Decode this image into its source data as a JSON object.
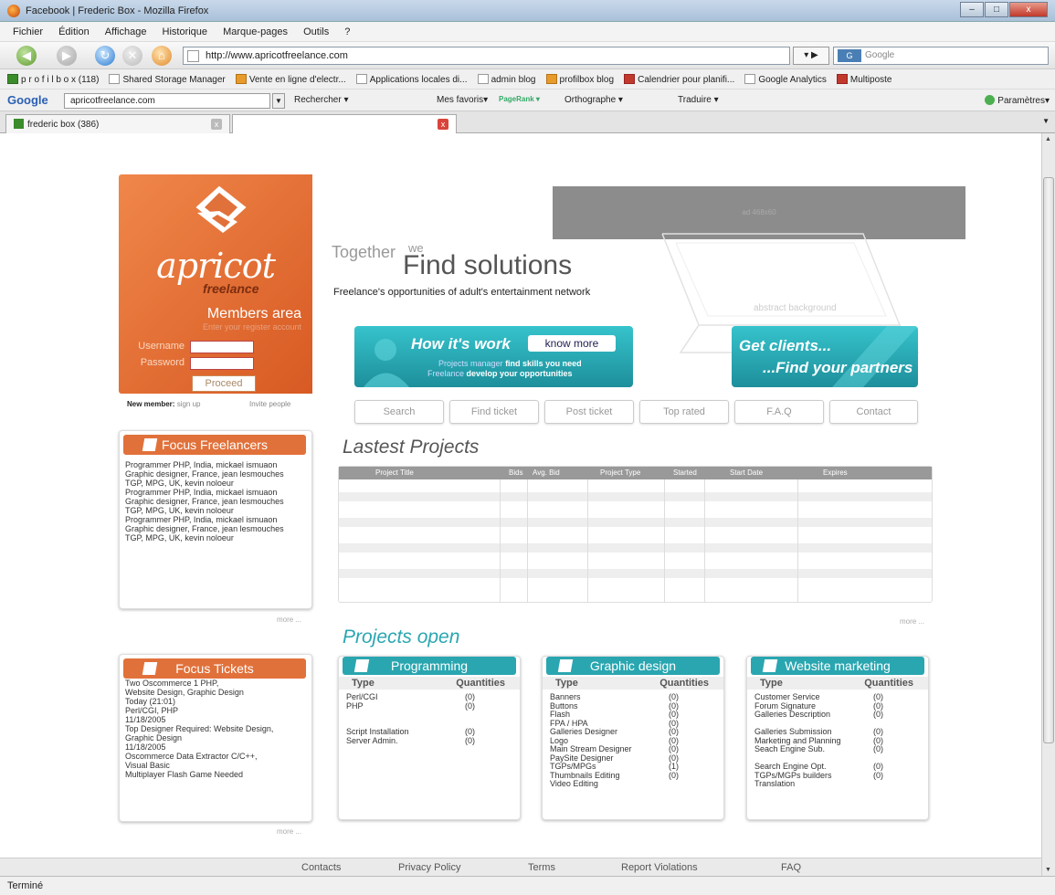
{
  "window": {
    "title": "Facebook | Frederic Box - Mozilla Firefox",
    "buttons": [
      "–",
      "□",
      "x"
    ]
  },
  "menu": [
    "Fichier",
    "Édition",
    "Affichage",
    "Historique",
    "Marque-pages",
    "Outils",
    "?"
  ],
  "nav": {
    "url": "http://www.apricotfreelance.com",
    "search_placeholder": "Google",
    "search_engine": "G"
  },
  "bookmarks": [
    {
      "label": "p r o f i l b o x (118)",
      "icon": "green"
    },
    {
      "label": "Shared Storage Manager",
      "icon": "doc"
    },
    {
      "label": "Vente en ligne d'electr...",
      "icon": "orange"
    },
    {
      "label": "Applications locales di...",
      "icon": "doc"
    },
    {
      "label": "admin blog",
      "icon": "doc"
    },
    {
      "label": "profilbox blog",
      "icon": "orange"
    },
    {
      "label": "Calendrier pour planifi...",
      "icon": "red"
    },
    {
      "label": "Google Analytics",
      "icon": "doc"
    },
    {
      "label": "Multiposte",
      "icon": "red"
    }
  ],
  "google_toolbar": {
    "logo": "Google",
    "input": "apricotfreelance.com",
    "items": [
      "Rechercher ▾",
      "Mes favoris▾",
      "PageRank ▾",
      "Orthographe ▾",
      "Traduire ▾"
    ],
    "settings": "Paramètres▾"
  },
  "tabs": [
    {
      "label": "frederic box (386)"
    },
    {
      "label": ""
    }
  ],
  "status": "Terminé",
  "site": {
    "logo_text": "apricot",
    "logo_sub": "freelance",
    "members_title": "Members area",
    "members_sub": "Enter your register account",
    "username_label": "Username",
    "password_label": "Password",
    "proceed": "Proceed",
    "new_member": "New member:",
    "sign_up": "sign up",
    "invite": "Invite people",
    "topbar_text": "ad 468x60",
    "together": "Together",
    "we": "we",
    "find": "Find solutions",
    "tagline": "Freelance's opportunities of adult's entertainment network",
    "ghost": "abstract background",
    "banner1": {
      "title": "How it's work",
      "btn": "know more",
      "line1a": "Projects manager",
      "line1b": "find skills you need",
      "line2a": "Freelance",
      "line2b": "develop your opportunities"
    },
    "banner2": {
      "title1": "Get clients...",
      "title2": "...Find your partners"
    },
    "navbuttons": [
      "Search",
      "Find ticket",
      "Post ticket",
      "Top rated",
      "F.A.Q",
      "Contact"
    ],
    "focus_freelancers": {
      "title": "Focus Freelancers",
      "lines": [
        "Programmer PHP,  India,  mickael ismuaon",
        "Graphic designer, France,  jean  lesmouches",
        "TGP, MPG,  UK,  kevin noloeur",
        "Programmer PHP,  India,  mickael ismuaon",
        "Graphic designer, France,  jean  lesmouches",
        "TGP, MPG,  UK,  kevin noloeur",
        "Programmer PHP,  India,  mickael ismuaon",
        "Graphic designer, France,  jean  lesmouches",
        "TGP, MPG,  UK,  kevin noloeur"
      ],
      "more": "more ..."
    },
    "focus_tickets": {
      "title": "Focus Tickets",
      "lines": [
        "Two Oscommerce      1 PHP,",
        "Website Design, Graphic Design",
        "Today (21:01)",
        "Perl/CGI, PHP",
        "11/18/2005",
        "Top Designer Required: Website Design,",
        "Graphic Design",
        "11/18/2005",
        "Oscommerce Data Extractor   C/C++,",
        "Visual Basic",
        "Multiplayer Flash Game Needed"
      ],
      "more": "more ..."
    },
    "latest": {
      "title": "Lastest Projects",
      "columns": [
        "Project Title",
        "Bids",
        "Avg. Bid",
        "Project Type",
        "Started",
        "Start Date",
        "Expires"
      ],
      "more": "more ..."
    },
    "projects_open": {
      "title": "Projects open",
      "type_label": "Type",
      "qty_label": "Quantities",
      "boxes": [
        {
          "title": "Programming",
          "rows": [
            {
              "type": "Perl/CGI",
              "qty": "(0)"
            },
            {
              "type": "PHP",
              "qty": "(0)"
            },
            {
              "type": "",
              "qty": ""
            },
            {
              "type": "",
              "qty": ""
            },
            {
              "type": "Script Installation",
              "qty": "(0)"
            },
            {
              "type": "Server Admin.",
              "qty": "(0)"
            }
          ]
        },
        {
          "title": "Graphic design",
          "rows": [
            {
              "type": "Banners",
              "qty": "(0)"
            },
            {
              "type": "Buttons",
              "qty": "(0)"
            },
            {
              "type": "Flash",
              "qty": "(0)"
            },
            {
              "type": "FPA / HPA",
              "qty": "(0)"
            },
            {
              "type": "Galleries Designer",
              "qty": "(0)"
            },
            {
              "type": "Logo",
              "qty": "(0)"
            },
            {
              "type": "Main Stream Designer",
              "qty": "(0)"
            },
            {
              "type": "PaySite Designer",
              "qty": "(0)"
            },
            {
              "type": "TGPs/MPGs",
              "qty": "(1)"
            },
            {
              "type": "Thumbnails Editing",
              "qty": "(0)"
            },
            {
              "type": "Video Editing",
              "qty": ""
            }
          ]
        },
        {
          "title": "Website marketing",
          "rows": [
            {
              "type": "Customer Service",
              "qty": "(0)"
            },
            {
              "type": "Forum Signature",
              "qty": "(0)"
            },
            {
              "type": "Galleries Description",
              "qty": "(0)"
            },
            {
              "type": "",
              "qty": ""
            },
            {
              "type": "Galleries Submission",
              "qty": "(0)"
            },
            {
              "type": "Marketing and Planning",
              "qty": "(0)"
            },
            {
              "type": "Seach Engine Sub.",
              "qty": "(0)"
            },
            {
              "type": "",
              "qty": ""
            },
            {
              "type": "Search Engine Opt.",
              "qty": "(0)"
            },
            {
              "type": "TGPs/MGPs builders",
              "qty": "(0)"
            },
            {
              "type": "Translation",
              "qty": ""
            }
          ]
        }
      ]
    },
    "footer": [
      "Contacts",
      "Privacy Policy",
      "Terms",
      "Report Violations",
      "FAQ"
    ]
  },
  "colors": {
    "orange": "#e1713a",
    "teal": "#2aa6b0",
    "gray_bar": "#8c8c8c"
  }
}
